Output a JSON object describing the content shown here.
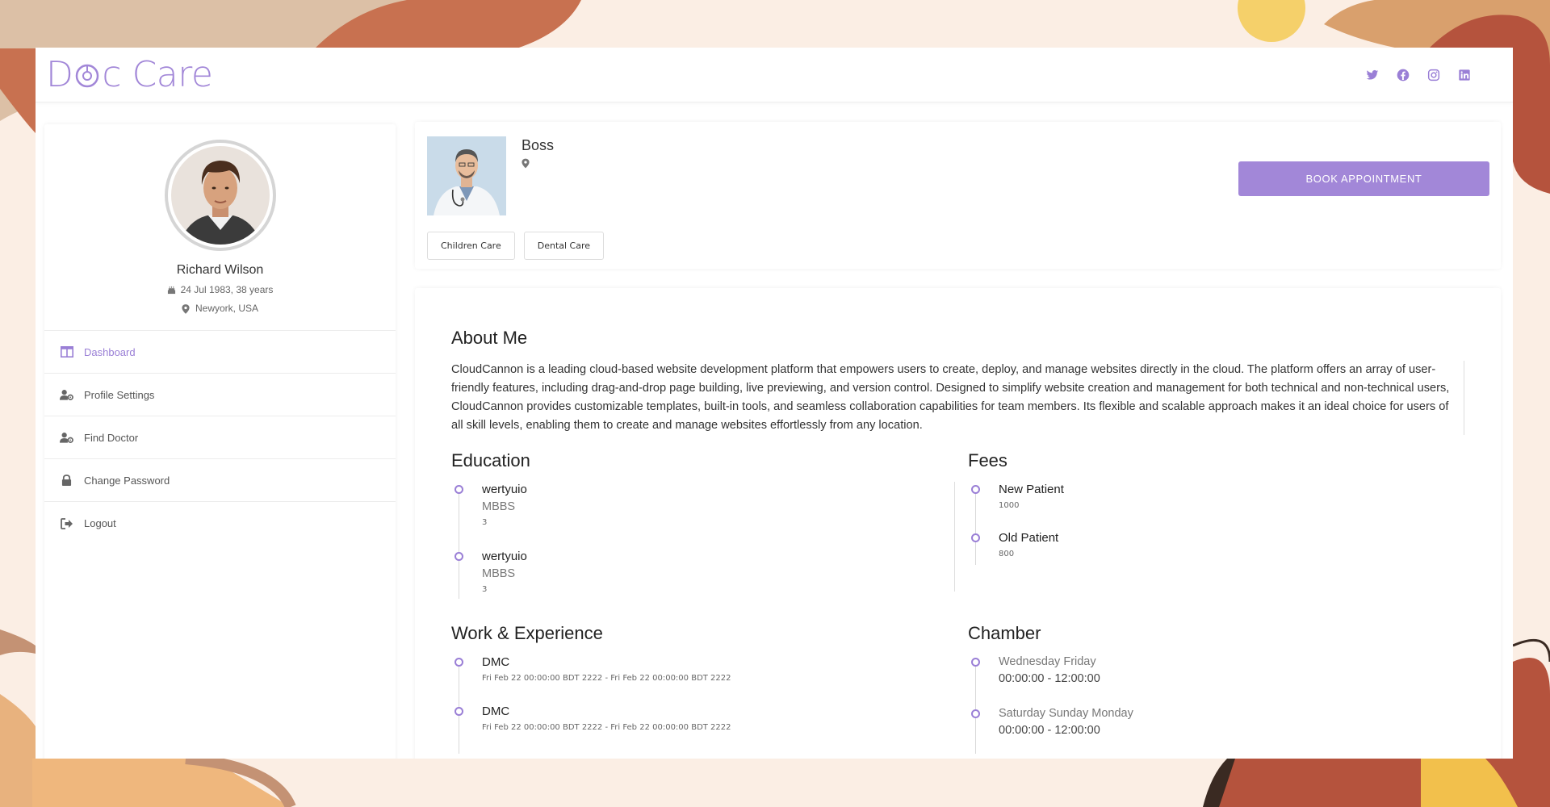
{
  "header": {
    "logo_text_prefix": "D",
    "logo_text_suffix": "c Care",
    "social_icons": [
      "twitter-icon",
      "facebook-icon",
      "instagram-icon",
      "linkedin-icon"
    ]
  },
  "colors": {
    "accent": "#a287d8",
    "background": "#fbeee4"
  },
  "profile": {
    "name": "Richard Wilson",
    "dob": "24 Jul 1983, 38 years",
    "location": "Newyork, USA"
  },
  "sidebar": {
    "items": [
      {
        "label": "Dashboard",
        "icon": "columns-icon",
        "active": true
      },
      {
        "label": "Profile Settings",
        "icon": "user-cog-icon",
        "active": false
      },
      {
        "label": "Find Doctor",
        "icon": "user-cog-icon",
        "active": false
      },
      {
        "label": "Change Password",
        "icon": "lock-icon",
        "active": false
      },
      {
        "label": "Logout",
        "icon": "logout-icon",
        "active": false
      }
    ]
  },
  "doctor": {
    "name": "Boss",
    "book_label": "BOOK APPOINTMENT",
    "tags": [
      "Children Care",
      "Dental Care"
    ]
  },
  "about": {
    "title": "About Me",
    "text": "CloudCannon is a leading cloud-based website development platform that empowers users to create, deploy, and manage websites directly in the cloud. The platform offers an array of user-friendly features, including drag-and-drop page building, live previewing, and version control. Designed to simplify website creation and management for both technical and non-technical users, CloudCannon provides customizable templates, built-in tools, and seamless collaboration capabilities for team members. Its flexible and scalable approach makes it an ideal choice for users of all skill levels, enabling them to create and manage websites effortlessly from any location."
  },
  "education": {
    "title": "Education",
    "items": [
      {
        "name": "wertyuio",
        "degree": "MBBS",
        "years": "3"
      },
      {
        "name": "wertyuio",
        "degree": "MBBS",
        "years": "3"
      }
    ]
  },
  "fees": {
    "title": "Fees",
    "items": [
      {
        "label": "New Patient",
        "amount": "1000"
      },
      {
        "label": "Old Patient",
        "amount": "800"
      }
    ]
  },
  "work": {
    "title": "Work & Experience",
    "items": [
      {
        "place": "DMC",
        "period": "Fri Feb 22 00:00:00 BDT 2222 - Fri Feb 22 00:00:00 BDT 2222"
      },
      {
        "place": "DMC",
        "period": "Fri Feb 22 00:00:00 BDT 2222 - Fri Feb 22 00:00:00 BDT 2222"
      }
    ]
  },
  "chamber": {
    "title": "Chamber",
    "items": [
      {
        "days": "Wednesday Friday",
        "time": "00:00:00 - 12:00:00"
      },
      {
        "days": "Saturday Sunday Monday",
        "time": "00:00:00 - 12:00:00"
      }
    ]
  }
}
